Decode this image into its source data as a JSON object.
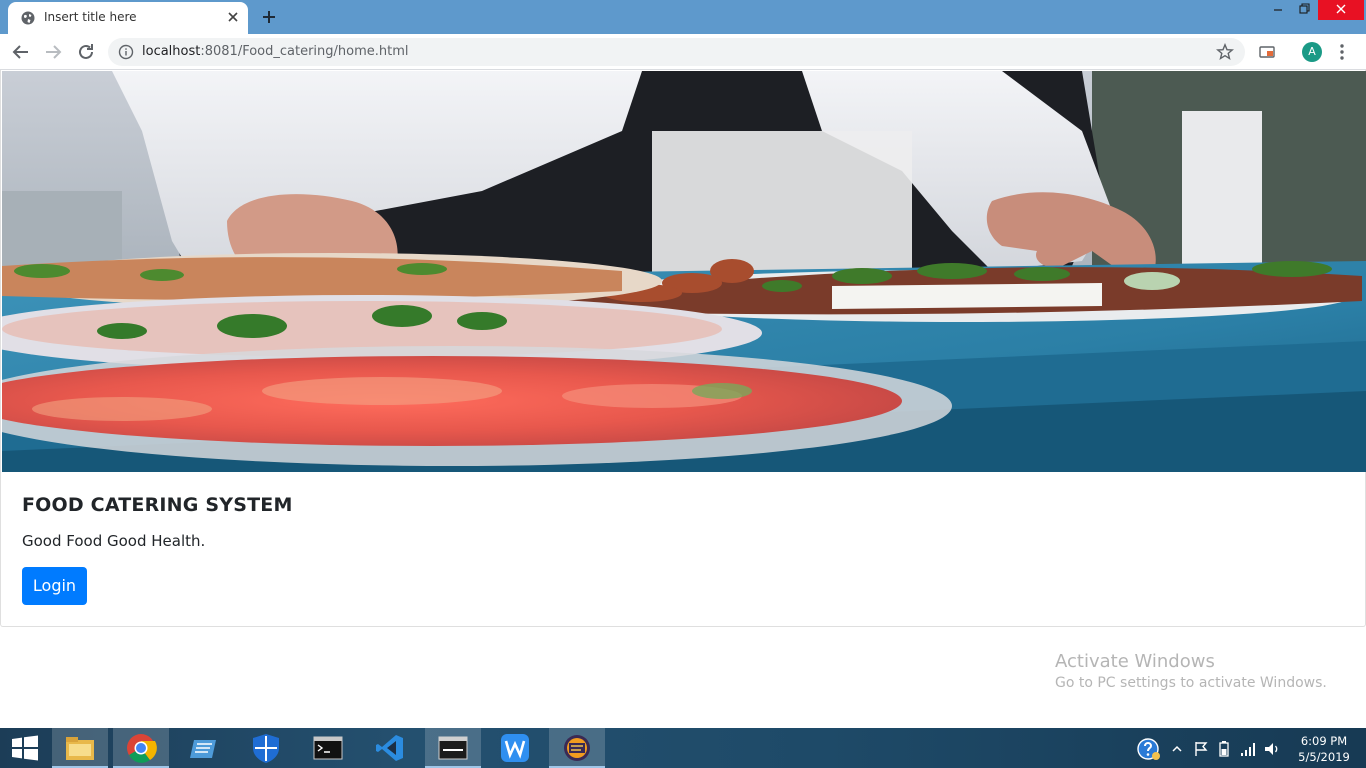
{
  "browser": {
    "tab_title": "Insert title here",
    "url_host": "localhost",
    "url_path": ":8081/Food_catering/home.html",
    "avatar_letter": "A"
  },
  "page": {
    "card_title": "FOOD CATERING SYSTEM",
    "card_text": "Good Food Good Health.",
    "login_label": "Login",
    "login_color": "#007bff"
  },
  "watermark": {
    "title": "Activate Windows",
    "subtitle": "Go to PC settings to activate Windows."
  },
  "taskbar": {
    "apps": [
      "start-icon",
      "file-explorer-icon",
      "chrome-icon",
      "remote-desktop-icon",
      "windows-defender-icon",
      "command-prompt-icon",
      "vscode-icon",
      "mysql-icon",
      "wps-writer-icon",
      "java-ee-ide-icon"
    ],
    "time": "6:09 PM",
    "date": "5/5/2019"
  }
}
